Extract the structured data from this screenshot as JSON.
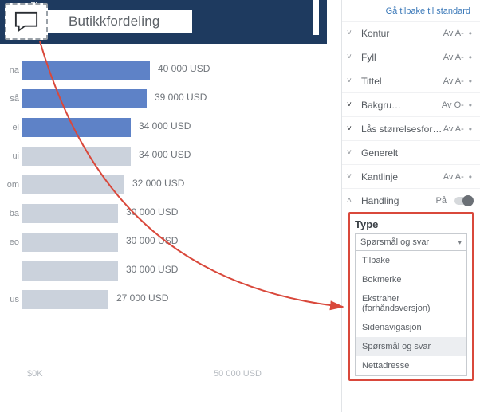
{
  "title": "Butikkfordeling",
  "reset_link": "Gå tilbake til standard",
  "chart_data": {
    "type": "bar",
    "title": "Butikkfordeling",
    "xlabel": "",
    "ylabel": "",
    "ylim": [
      0,
      50000
    ],
    "value_suffix": " USD",
    "categories": [
      "na",
      "så",
      "el",
      "ui",
      "om",
      "ba",
      "eo",
      "",
      "us"
    ],
    "values": [
      40000,
      39000,
      34000,
      34000,
      32000,
      30000,
      30000,
      30000,
      27000
    ],
    "highlighted": [
      true,
      true,
      true,
      false,
      false,
      false,
      false,
      false,
      false
    ],
    "display_values": [
      "40 000 USD",
      "39 000 USD",
      "34 000 USD",
      "34 000 USD",
      "32 000 USD",
      "30 000 USD",
      "30 000 USD",
      "30 000 USD",
      "27 000 USD"
    ],
    "axis_ticks": [
      "$0K",
      "50 000 USD"
    ]
  },
  "sections": [
    {
      "name": "Kontur",
      "state": "Av A-",
      "chev": "down"
    },
    {
      "name": "Fyll",
      "state": "Av A-",
      "chev": "down"
    },
    {
      "name": "Tittel",
      "state": "Av A-",
      "chev": "down"
    },
    {
      "name": "Bakgru…",
      "state": "Av O-",
      "chev": "down-bold"
    },
    {
      "name": "Lås størrelsesfor…",
      "state": "Av A-",
      "chev": "down-bold"
    },
    {
      "name": "Generelt",
      "state": "",
      "chev": "down"
    },
    {
      "name": "Kantlinje",
      "state": "Av A-",
      "chev": "down"
    },
    {
      "name": "Handling",
      "state": "På",
      "chev": "up",
      "toggle": true
    }
  ],
  "type_panel": {
    "header": "Type",
    "selected": "Spørsmål og svar",
    "options": [
      "Tilbake",
      "Bokmerke",
      "Ekstraher (forhåndsversjon)",
      "Sidenavigasjon",
      "Spørsmål og svar",
      "Nettadresse"
    ],
    "highlight_index": 4
  }
}
